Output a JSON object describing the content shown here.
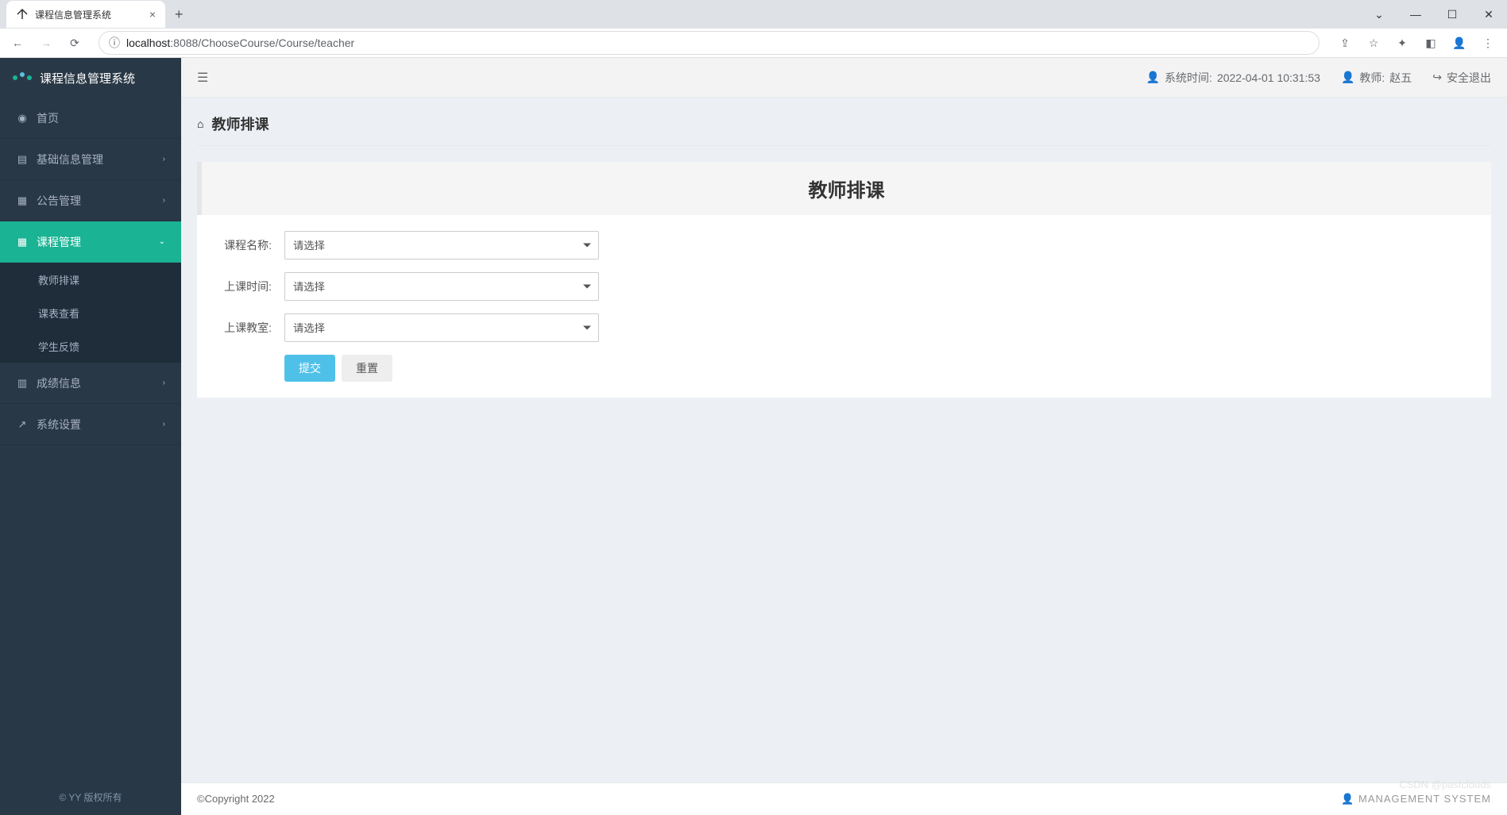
{
  "browser": {
    "tab_title": "课程信息管理系统",
    "url_host": "localhost",
    "url_port": ":8088",
    "url_path": "/ChooseCourse/Course/teacher"
  },
  "sidebar": {
    "app_name": "课程信息管理系统",
    "logo_colors": [
      "#1ab394",
      "#5bc0de",
      "#1ab394"
    ],
    "items": [
      {
        "icon": "dashboard",
        "label": "首页"
      },
      {
        "icon": "th-list",
        "label": "基础信息管理",
        "has_children": true
      },
      {
        "icon": "calendar",
        "label": "公告管理",
        "has_children": true
      },
      {
        "icon": "table",
        "label": "课程管理",
        "has_children": true,
        "active": true
      },
      {
        "icon": "bar-chart",
        "label": "成绩信息",
        "has_children": true
      },
      {
        "icon": "external",
        "label": "系统设置",
        "has_children": true
      }
    ],
    "submenu_course": [
      {
        "label": "教师排课"
      },
      {
        "label": "课表查看"
      },
      {
        "label": "学生反馈"
      }
    ],
    "footer": "© YY 版权所有"
  },
  "topbar": {
    "system_time_label": "系统时间:",
    "system_time_value": "2022-04-01 10:31:53",
    "user_role": "教师:",
    "user_name": "赵五",
    "logout_label": "安全退出"
  },
  "page": {
    "title": "教师排课",
    "panel_title": "教师排课"
  },
  "form": {
    "fields": [
      {
        "label": "课程名称:",
        "placeholder": "请选择"
      },
      {
        "label": "上课时间:",
        "placeholder": "请选择"
      },
      {
        "label": "上课教室:",
        "placeholder": "请选择"
      }
    ],
    "submit_label": "提交",
    "reset_label": "重置"
  },
  "footer": {
    "copyright": "©Copyright 2022",
    "right_text": "MANAGEMENT SYSTEM",
    "watermark": "CSDN @pastclouds"
  }
}
